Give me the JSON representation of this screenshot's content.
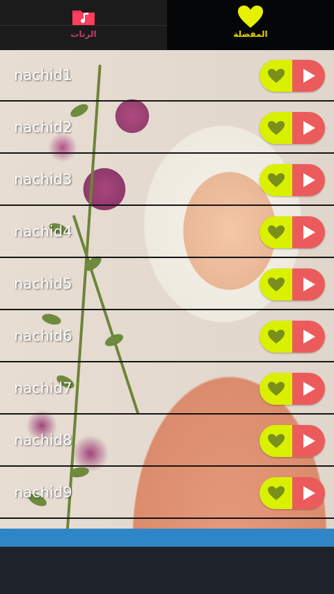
{
  "tabs": [
    {
      "label": "الرنات",
      "icon": "music-folder-icon",
      "color": "#c04070"
    },
    {
      "label": "المفضلة",
      "icon": "heart-icon",
      "color": "#e8d200"
    }
  ],
  "list": {
    "items": [
      {
        "label": "nachid1"
      },
      {
        "label": "nachid2"
      },
      {
        "label": "nachid3"
      },
      {
        "label": "nachid4"
      },
      {
        "label": "nachid5"
      },
      {
        "label": "nachid6"
      },
      {
        "label": "nachid7"
      },
      {
        "label": "nachid8"
      },
      {
        "label": "nachid9"
      }
    ]
  },
  "colors": {
    "favorite_button": "#d9f000",
    "play_button": "#ec5b5b",
    "accent_bar": "#2f86c6"
  }
}
